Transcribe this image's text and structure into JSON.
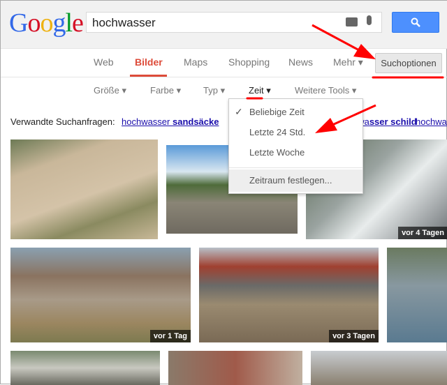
{
  "header": {
    "logo": "Google",
    "query": "hochwasser",
    "search_button_icon": "search-icon"
  },
  "nav": {
    "items": [
      "Web",
      "Bilder",
      "Maps",
      "Shopping",
      "News",
      "Mehr ▾"
    ],
    "active": "Bilder",
    "options": "Suchoptionen"
  },
  "tools": [
    "Größe ▾",
    "Farbe ▾",
    "Typ ▾",
    "Zeit ▾",
    "Weitere Tools ▾"
  ],
  "time_menu": {
    "items": [
      "Beliebige Zeit",
      "Letzte 24 Std.",
      "Letzte Woche",
      "Zeitraum festlegen..."
    ],
    "selected": "Beliebige Zeit"
  },
  "related": {
    "label": "Verwandte Suchanfragen:",
    "links": [
      {
        "plain": "hochwasser ",
        "bold": "sandsäcke"
      },
      {
        "plain": "hochwa",
        "bold": "sser schild"
      },
      {
        "plain": "hochwa",
        "bold": ""
      }
    ]
  },
  "images": {
    "badges": [
      "vor 4 Tagen",
      "vor 1 Tag",
      "vor 3 Tagen"
    ]
  },
  "annotations": {
    "color": "#ff0000"
  }
}
